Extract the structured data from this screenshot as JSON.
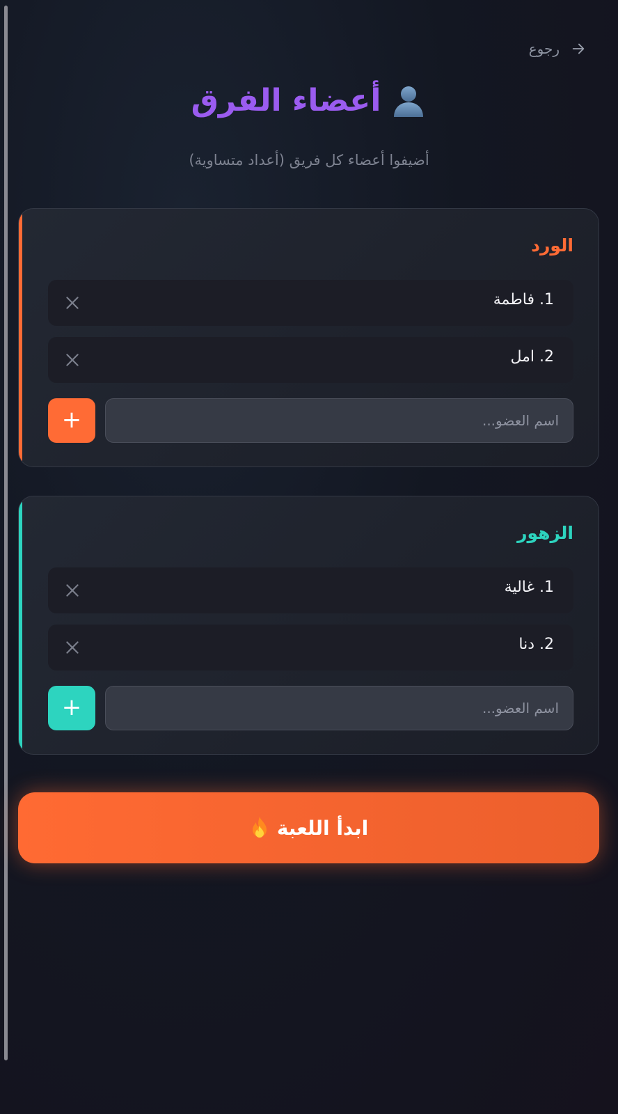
{
  "nav": {
    "back_label": "رجوع"
  },
  "header": {
    "title": "أعضاء الفرق",
    "subtitle": "أضيفوا أعضاء كل فريق (أعداد متساوية)"
  },
  "teams": [
    {
      "name": "الورد",
      "color": "#ff6b35",
      "members": [
        "1. فاطمة",
        "2. امل"
      ],
      "input_placeholder": "اسم العضو...",
      "add_label": "+"
    },
    {
      "name": "الزهور",
      "color": "#2dd4bf",
      "members": [
        "1. غالية",
        "2. دنا"
      ],
      "input_placeholder": "اسم العضو...",
      "add_label": "+"
    }
  ],
  "start_button": {
    "label": "ابدأ اللعبة"
  },
  "icons": {
    "back": "arrow-right-icon",
    "title": "user-icon",
    "remove": "close-icon",
    "start": "flame-icon"
  }
}
